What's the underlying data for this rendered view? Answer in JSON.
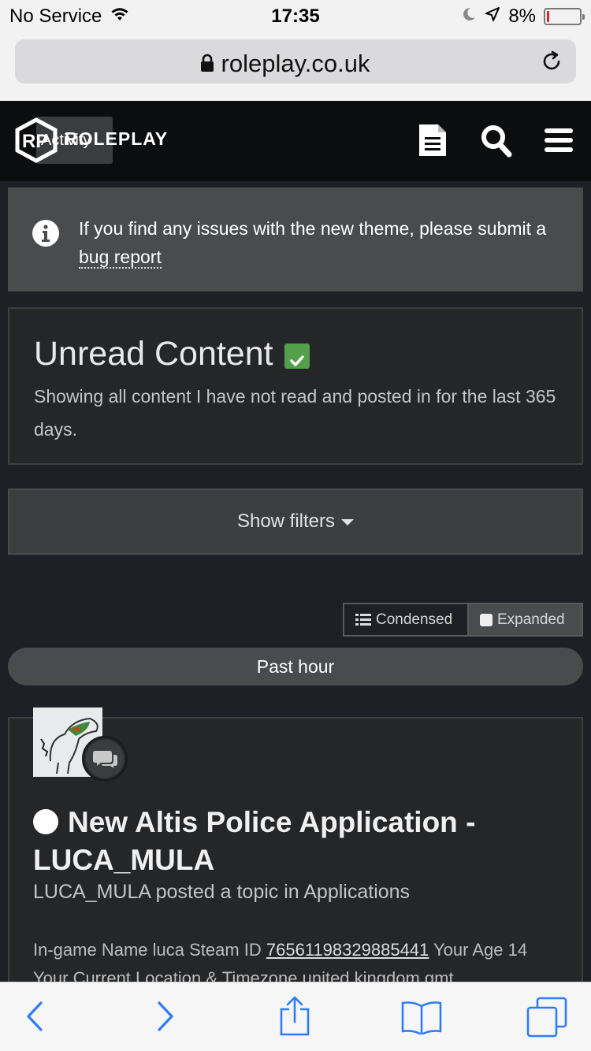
{
  "status_bar": {
    "carrier": "No Service",
    "time": "17:35",
    "battery_percent": "8%",
    "battery_level": 0.08
  },
  "browser": {
    "domain": "roleplay.co.uk"
  },
  "site_header": {
    "logo_text": "ROLEPLAY",
    "activity_label": "Activity"
  },
  "notice": {
    "text_before_link": "If you find any issues with the new theme, please submit a ",
    "link_text": "bug report"
  },
  "page": {
    "title": "Unread Content",
    "description": "Showing all content I have not read and posted in for the last 365 days.",
    "filters_label": "Show filters",
    "view_condensed": "Condensed",
    "view_expanded": "Expanded",
    "time_group": "Past hour"
  },
  "post": {
    "title": "New Altis Police Application - LUCA_MULA",
    "meta": "LUCA_MULA posted a topic in Applications",
    "snippet_before": "In-game Name luca Steam ID ",
    "steam_id": "76561198329885441",
    "snippet_after": " Your Age 14 Your Current Location & Timezone united kingdom gmt"
  },
  "colors": {
    "accent_green": "#53a04c",
    "ios_blue": "#2f7cf6"
  }
}
